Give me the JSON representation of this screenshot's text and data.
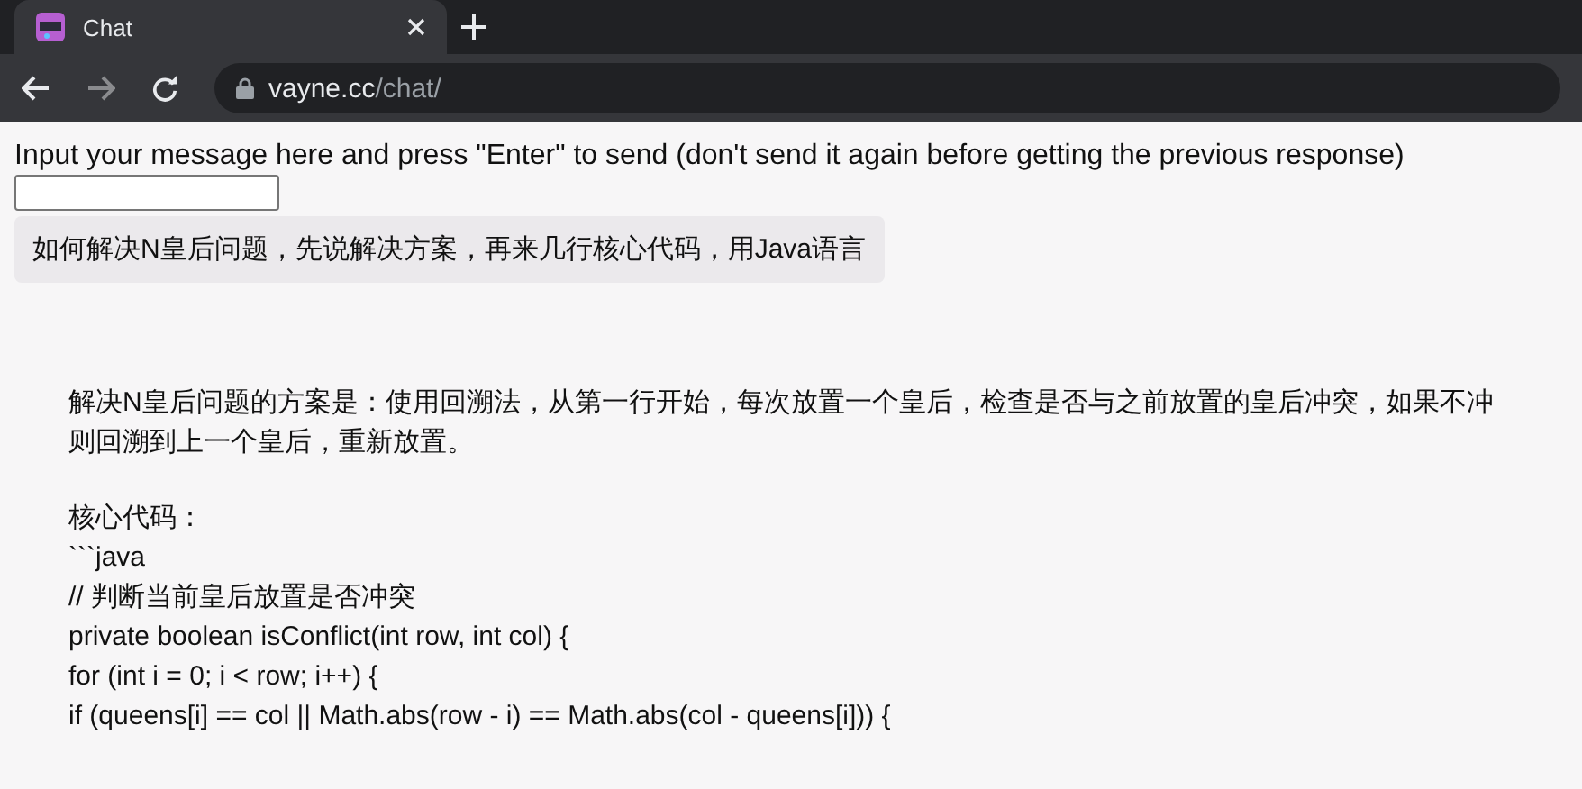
{
  "browser": {
    "tab": {
      "title": "Chat",
      "selected": true
    },
    "url": {
      "host": "vayne.cc",
      "path": "/chat/"
    }
  },
  "instruction": "Input your message here and press \"Enter\" to send (don't send it again before getting the previous response)",
  "question": "如何解决N皇后问题，先说解决方案，再来几行核心代码，用Java语言",
  "answer": {
    "paragraphs": [
      [
        "解决N皇后问题的方案是：使用回溯法，从第一行开始，每次放置一个皇后，检查是否与之前放置的皇后冲突，如果不冲",
        "则回溯到上一个皇后，重新放置。"
      ],
      [
        "核心代码：",
        "```java",
        "// 判断当前皇后放置是否冲突",
        "private boolean isConflict(int row, int col) {",
        "for (int i = 0; i < row; i++) {",
        "if (queens[i] == col || Math.abs(row - i) == Math.abs(col - queens[i])) {"
      ]
    ]
  }
}
